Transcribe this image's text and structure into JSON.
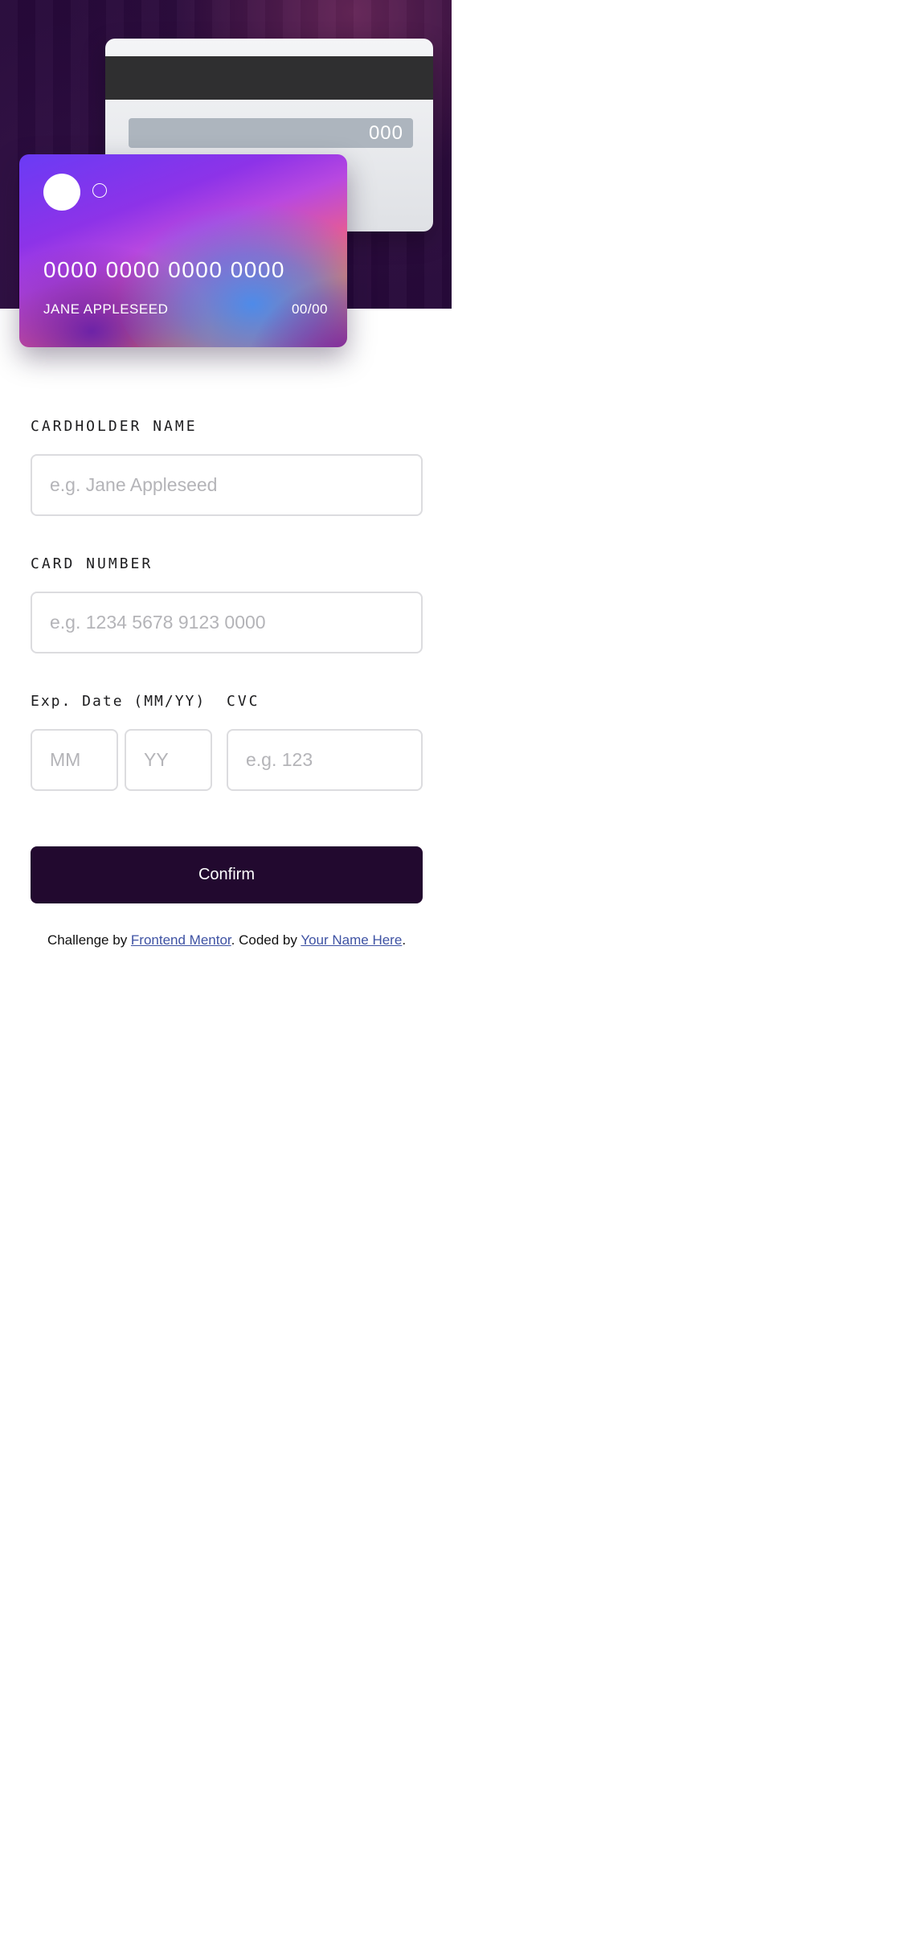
{
  "card_back": {
    "cvc": "000"
  },
  "card_front": {
    "number": "0000 0000 0000 0000",
    "holder": "JANE APPLESEED",
    "expiry": "00/00"
  },
  "form": {
    "cardholder_label": "CARDHOLDER NAME",
    "cardholder_placeholder": "e.g. Jane Appleseed",
    "number_label": "CARD NUMBER",
    "number_placeholder": "e.g. 1234 5678 9123 0000",
    "exp_label": "Exp. Date (MM/YY)",
    "mm_placeholder": "MM",
    "yy_placeholder": "YY",
    "cvc_label": "CVC",
    "cvc_placeholder": "e.g. 123",
    "confirm_label": "Confirm"
  },
  "footer": {
    "prefix": "Challenge by ",
    "link1": "Frontend Mentor",
    "middle": ". Coded by ",
    "link2": "Your Name Here",
    "suffix": "."
  },
  "colors": {
    "hero_bg": "#27093a",
    "button_bg": "#22092f",
    "link": "#3e52a3",
    "input_border": "#dcdcdf"
  }
}
